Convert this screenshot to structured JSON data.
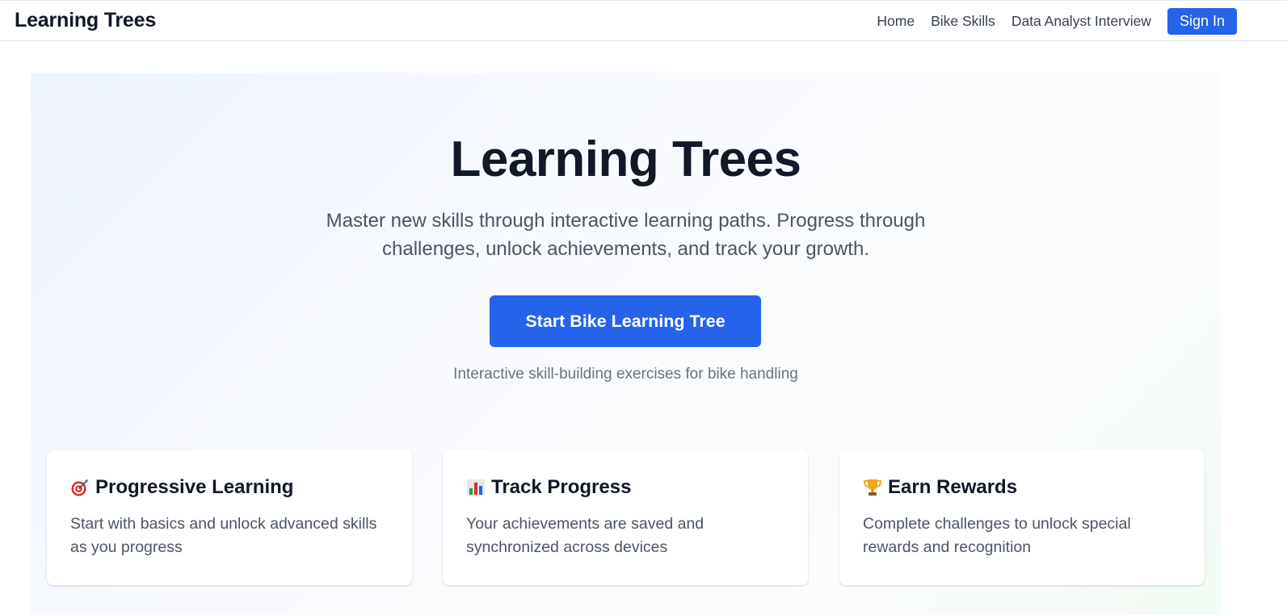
{
  "header": {
    "brand": "Learning Trees",
    "nav": {
      "home": "Home",
      "bike_skills": "Bike Skills",
      "data_analyst_interview": "Data Analyst Interview",
      "sign_in": "Sign In"
    }
  },
  "hero": {
    "title": "Learning Trees",
    "subtitle": "Master new skills through interactive learning paths. Progress through challenges, unlock achievements, and track your growth.",
    "cta_label": "Start Bike Learning Tree",
    "cta_caption": "Interactive skill-building exercises for bike handling"
  },
  "features": [
    {
      "icon": "target-icon",
      "title": "Progressive Learning",
      "description": "Start with basics and unlock advanced skills as you progress"
    },
    {
      "icon": "bar-chart-icon",
      "title": "Track Progress",
      "description": "Your achievements are saved and synchronized across devices"
    },
    {
      "icon": "trophy-icon",
      "title": "Earn Rewards",
      "description": "Complete challenges to unlock special rewards and recognition"
    }
  ],
  "colors": {
    "accent": "#2563eb",
    "text_primary": "#111827",
    "text_secondary": "#4b5563"
  }
}
